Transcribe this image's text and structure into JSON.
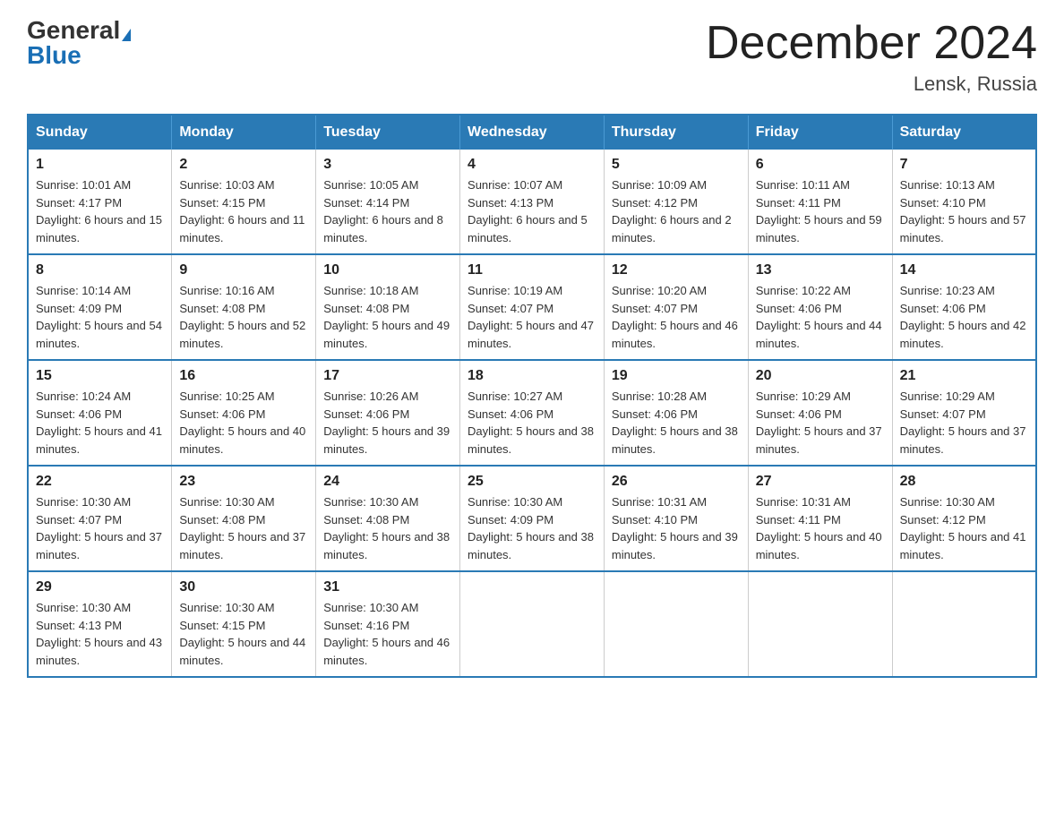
{
  "header": {
    "logo_general": "General",
    "logo_blue": "Blue",
    "month_title": "December 2024",
    "location": "Lensk, Russia"
  },
  "weekdays": [
    "Sunday",
    "Monday",
    "Tuesday",
    "Wednesday",
    "Thursday",
    "Friday",
    "Saturday"
  ],
  "weeks": [
    [
      {
        "day": "1",
        "sunrise": "10:01 AM",
        "sunset": "4:17 PM",
        "daylight": "6 hours and 15 minutes."
      },
      {
        "day": "2",
        "sunrise": "10:03 AM",
        "sunset": "4:15 PM",
        "daylight": "6 hours and 11 minutes."
      },
      {
        "day": "3",
        "sunrise": "10:05 AM",
        "sunset": "4:14 PM",
        "daylight": "6 hours and 8 minutes."
      },
      {
        "day": "4",
        "sunrise": "10:07 AM",
        "sunset": "4:13 PM",
        "daylight": "6 hours and 5 minutes."
      },
      {
        "day": "5",
        "sunrise": "10:09 AM",
        "sunset": "4:12 PM",
        "daylight": "6 hours and 2 minutes."
      },
      {
        "day": "6",
        "sunrise": "10:11 AM",
        "sunset": "4:11 PM",
        "daylight": "5 hours and 59 minutes."
      },
      {
        "day": "7",
        "sunrise": "10:13 AM",
        "sunset": "4:10 PM",
        "daylight": "5 hours and 57 minutes."
      }
    ],
    [
      {
        "day": "8",
        "sunrise": "10:14 AM",
        "sunset": "4:09 PM",
        "daylight": "5 hours and 54 minutes."
      },
      {
        "day": "9",
        "sunrise": "10:16 AM",
        "sunset": "4:08 PM",
        "daylight": "5 hours and 52 minutes."
      },
      {
        "day": "10",
        "sunrise": "10:18 AM",
        "sunset": "4:08 PM",
        "daylight": "5 hours and 49 minutes."
      },
      {
        "day": "11",
        "sunrise": "10:19 AM",
        "sunset": "4:07 PM",
        "daylight": "5 hours and 47 minutes."
      },
      {
        "day": "12",
        "sunrise": "10:20 AM",
        "sunset": "4:07 PM",
        "daylight": "5 hours and 46 minutes."
      },
      {
        "day": "13",
        "sunrise": "10:22 AM",
        "sunset": "4:06 PM",
        "daylight": "5 hours and 44 minutes."
      },
      {
        "day": "14",
        "sunrise": "10:23 AM",
        "sunset": "4:06 PM",
        "daylight": "5 hours and 42 minutes."
      }
    ],
    [
      {
        "day": "15",
        "sunrise": "10:24 AM",
        "sunset": "4:06 PM",
        "daylight": "5 hours and 41 minutes."
      },
      {
        "day": "16",
        "sunrise": "10:25 AM",
        "sunset": "4:06 PM",
        "daylight": "5 hours and 40 minutes."
      },
      {
        "day": "17",
        "sunrise": "10:26 AM",
        "sunset": "4:06 PM",
        "daylight": "5 hours and 39 minutes."
      },
      {
        "day": "18",
        "sunrise": "10:27 AM",
        "sunset": "4:06 PM",
        "daylight": "5 hours and 38 minutes."
      },
      {
        "day": "19",
        "sunrise": "10:28 AM",
        "sunset": "4:06 PM",
        "daylight": "5 hours and 38 minutes."
      },
      {
        "day": "20",
        "sunrise": "10:29 AM",
        "sunset": "4:06 PM",
        "daylight": "5 hours and 37 minutes."
      },
      {
        "day": "21",
        "sunrise": "10:29 AM",
        "sunset": "4:07 PM",
        "daylight": "5 hours and 37 minutes."
      }
    ],
    [
      {
        "day": "22",
        "sunrise": "10:30 AM",
        "sunset": "4:07 PM",
        "daylight": "5 hours and 37 minutes."
      },
      {
        "day": "23",
        "sunrise": "10:30 AM",
        "sunset": "4:08 PM",
        "daylight": "5 hours and 37 minutes."
      },
      {
        "day": "24",
        "sunrise": "10:30 AM",
        "sunset": "4:08 PM",
        "daylight": "5 hours and 38 minutes."
      },
      {
        "day": "25",
        "sunrise": "10:30 AM",
        "sunset": "4:09 PM",
        "daylight": "5 hours and 38 minutes."
      },
      {
        "day": "26",
        "sunrise": "10:31 AM",
        "sunset": "4:10 PM",
        "daylight": "5 hours and 39 minutes."
      },
      {
        "day": "27",
        "sunrise": "10:31 AM",
        "sunset": "4:11 PM",
        "daylight": "5 hours and 40 minutes."
      },
      {
        "day": "28",
        "sunrise": "10:30 AM",
        "sunset": "4:12 PM",
        "daylight": "5 hours and 41 minutes."
      }
    ],
    [
      {
        "day": "29",
        "sunrise": "10:30 AM",
        "sunset": "4:13 PM",
        "daylight": "5 hours and 43 minutes."
      },
      {
        "day": "30",
        "sunrise": "10:30 AM",
        "sunset": "4:15 PM",
        "daylight": "5 hours and 44 minutes."
      },
      {
        "day": "31",
        "sunrise": "10:30 AM",
        "sunset": "4:16 PM",
        "daylight": "5 hours and 46 minutes."
      },
      null,
      null,
      null,
      null
    ]
  ]
}
